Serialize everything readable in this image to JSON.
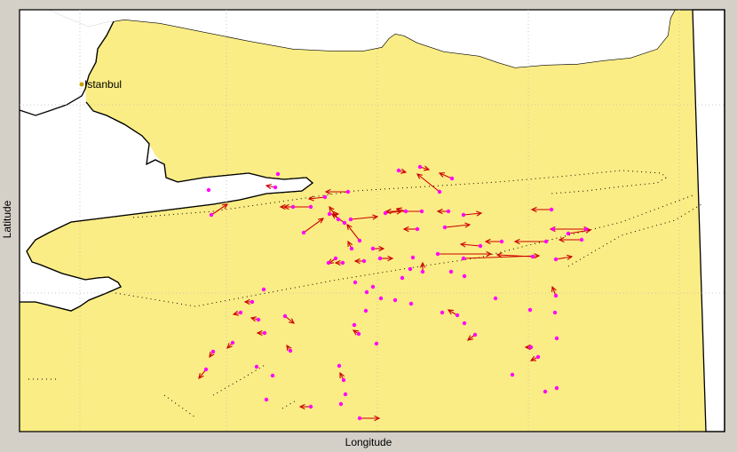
{
  "map": {
    "xlabel": "Longitude",
    "ylabel": "Latitude",
    "city": {
      "name": "Istanbul",
      "marker_color": "#c8a000"
    },
    "colors": {
      "land": "#fbed85",
      "sea": "#ffffff",
      "coast": "#000000",
      "frame_bg": "#d4d0c8",
      "station": "#ff00ff",
      "vector": "#cc0000",
      "grid": "#bbbbbb",
      "faults": "#000000"
    },
    "legend": "none",
    "grid": true
  }
}
